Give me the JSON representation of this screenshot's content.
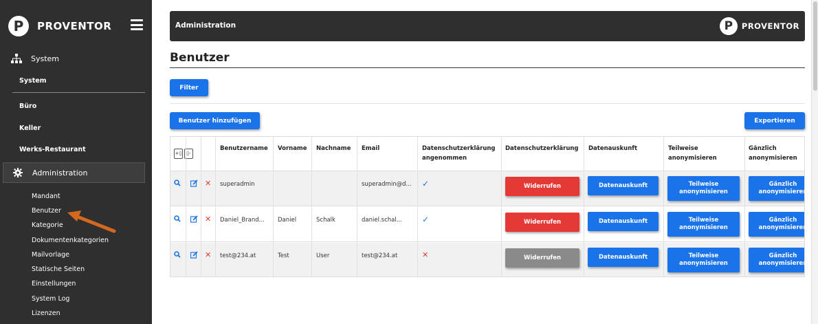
{
  "sidebar": {
    "brand": "PROVENTOR",
    "logo_letter": "P",
    "group_system": "System",
    "items_system": [
      "System",
      "Büro",
      "Keller",
      "Werks-Restaurant"
    ],
    "group_admin": "Administration",
    "items_admin": [
      "Mandant",
      "Benutzer",
      "Kategorie",
      "Dokumentenkategorien",
      "Mailvorlage",
      "Statische Seiten",
      "Einstellungen",
      "System Log",
      "Lizenzen"
    ]
  },
  "topbar": {
    "title": "Administration",
    "brand": "PROVENTOR",
    "logo_letter": "P"
  },
  "page": {
    "title": "Benutzer",
    "filter_button": "Filter",
    "add_button": "Benutzer hinzufügen",
    "export_button": "Exportieren"
  },
  "table": {
    "headers": [
      "Benutzername",
      "Vorname",
      "Nachname",
      "Email",
      "Datenschutzerklärung angenommen",
      "Datenschutzerklärung",
      "Datenauskunft",
      "Teilweise anonymisieren",
      "Gänzlich anonymisieren"
    ],
    "rows": [
      {
        "username": "superadmin",
        "firstname": "",
        "lastname": "",
        "email": "superadmin@d...",
        "accepted": true
      },
      {
        "username": "Daniel_Brand...",
        "firstname": "Daniel",
        "lastname": "Schalk",
        "email": "daniel.schal...",
        "accepted": true
      },
      {
        "username": "test@234.at",
        "firstname": "Test",
        "lastname": "User",
        "email": "test@234.at",
        "accepted": false
      }
    ],
    "btn_revoke": "Widerrufen",
    "btn_info": "Datenauskunft",
    "btn_partial": "Teilweise anonymisieren",
    "btn_full": "Gänzlich anonymisieren"
  },
  "colors": {
    "sidebar_bg": "#2f2f2f",
    "primary": "#1a73e8",
    "danger": "#e53935",
    "disabled": "#8a8a8a"
  }
}
